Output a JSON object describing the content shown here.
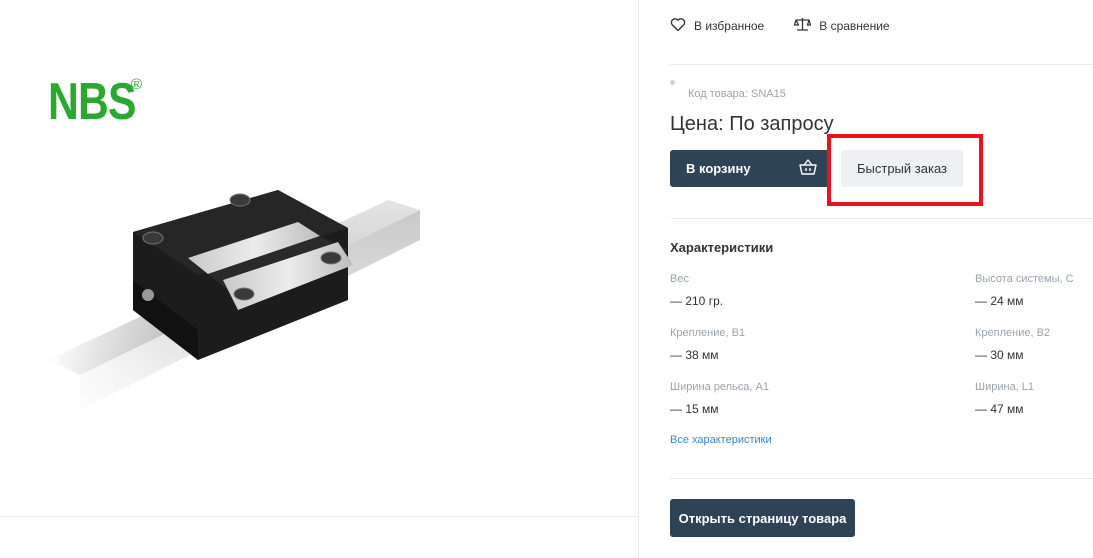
{
  "brand": {
    "logo_text": "NBS",
    "logo_mark": "®",
    "color": "#2aa830"
  },
  "actions": {
    "favorite_label": "В избранное",
    "compare_label": "В сравнение"
  },
  "product": {
    "sku_label": "Код товара: SNA15",
    "price_label": "Цена: По запросу"
  },
  "buttons": {
    "cart_label": "В корзину",
    "quick_order_label": "Быстрый заказ",
    "open_page_label": "Открыть страницу товара"
  },
  "specs": {
    "title": "Характеристики",
    "items": [
      {
        "label": "Вес",
        "value": "— 210 гр."
      },
      {
        "label": "Высота системы, C",
        "value": "— 24 мм"
      },
      {
        "label": "Крепление, B1",
        "value": "— 38 мм"
      },
      {
        "label": "Крепление, B2",
        "value": "— 30 мм"
      },
      {
        "label": "Ширина рельса, A1",
        "value": "— 15 мм"
      },
      {
        "label": "Ширина, L1",
        "value": "— 47 мм"
      }
    ],
    "all_link": "Все характеристики"
  },
  "colors": {
    "primary": "#2f4356",
    "highlight": "#e8141d",
    "link": "#3c84d1"
  }
}
